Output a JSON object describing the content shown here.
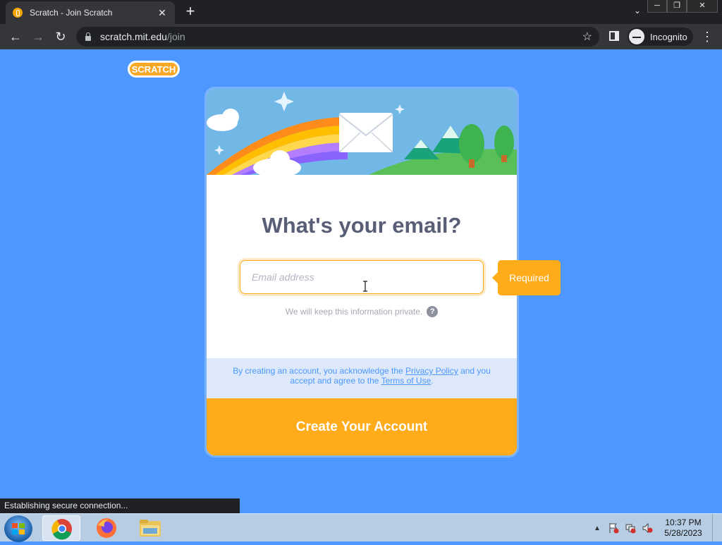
{
  "browser": {
    "tab_title": "Scratch - Join Scratch",
    "url_host": "scratch.mit.edu",
    "url_path": "/join",
    "incognito_label": "Incognito",
    "status_text": "Establishing secure connection..."
  },
  "join_form": {
    "logo_text": "SCRATCH",
    "heading": "What's your email?",
    "email_placeholder": "Email address",
    "email_value": "",
    "privacy_hint": "We will keep this information private.",
    "required_tooltip": "Required",
    "legal_before": "By creating an account, you acknowledge the ",
    "privacy_link": "Privacy Policy",
    "legal_middle": " and you accept and agree to the ",
    "terms_link": "Terms of Use",
    "legal_after": ".",
    "create_button": "Create Your Account"
  },
  "taskbar": {
    "time": "10:37 PM",
    "date": "5/28/2023"
  },
  "colors": {
    "page_background": "#4d97ff",
    "accent_orange": "#ffab1a",
    "heading_text": "#575e75",
    "legal_background": "#dde9fa"
  }
}
